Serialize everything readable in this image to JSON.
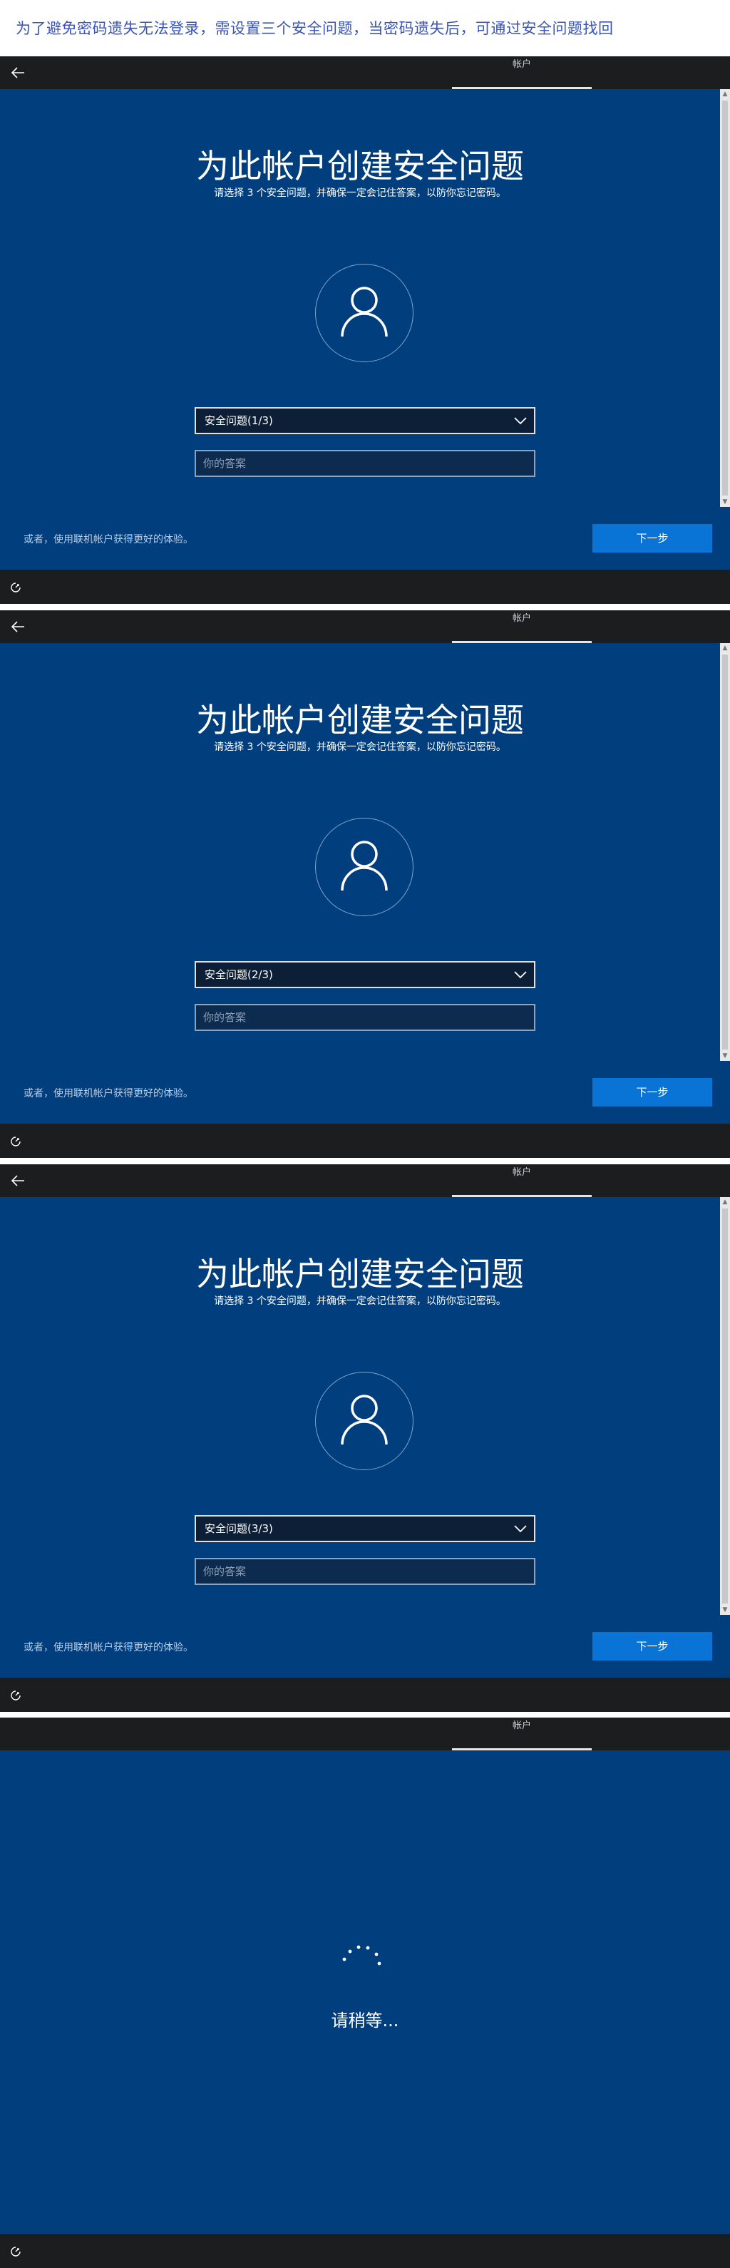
{
  "caption": "为了避免密码遗失无法登录，需设置三个安全问题，当密码遗失后，可通过安全问题找回",
  "topbar": {
    "tab_label": "帐户"
  },
  "page": {
    "title": "为此帐户创建安全问题",
    "subtitle": "请选择 3 个安全问题，并确保一定会记住答案，以防你忘记密码。",
    "answer_placeholder": "你的答案",
    "alt_link": "或者，使用联机帐户获得更好的体验。",
    "next_label": "下一步"
  },
  "steps": [
    {
      "question_label": "安全问题(1/3)"
    },
    {
      "question_label": "安全问题(2/3)"
    },
    {
      "question_label": "安全问题(3/3)"
    }
  ],
  "wait": {
    "text": "请稍等..."
  },
  "colors": {
    "background": "#003e7e",
    "bar": "#1b1d1f",
    "accent": "#0a74d6",
    "caption": "#3a55b8"
  },
  "icons": [
    "back-arrow-icon",
    "user-avatar-icon",
    "chevron-down-icon",
    "ease-of-access-icon",
    "loading-dots-icon"
  ]
}
